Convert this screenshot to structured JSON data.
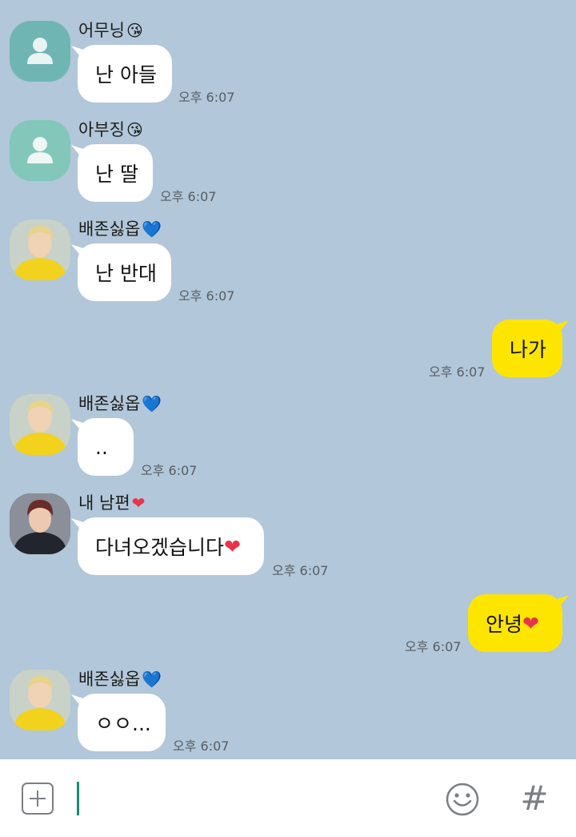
{
  "messages": [
    {
      "sender": "어무닝",
      "sender_emoji": "😘",
      "text": "난 아들",
      "time": "오후 6:07"
    },
    {
      "sender": "아부징",
      "sender_emoji": "😘",
      "text": "난 딸",
      "time": "오후 6:07"
    },
    {
      "sender": "배존싫옵",
      "sender_emoji": "💙",
      "text": "난 반대",
      "time": "오후 6:07"
    },
    {
      "text": "나가",
      "time": "오후 6:07"
    },
    {
      "sender": "배존싫옵",
      "sender_emoji": "💙",
      "text": "..",
      "time": "오후 6:07"
    },
    {
      "sender": "내 남편",
      "sender_emoji": "❤",
      "text": "다녀오겠습니다",
      "text_emoji": "❤",
      "time": "오후 6:07"
    },
    {
      "text": "안녕",
      "text_emoji": "❤",
      "time": "오후 6:07"
    },
    {
      "sender": "배존싫옵",
      "sender_emoji": "💙",
      "text": "ㅇㅇ...",
      "time": "오후 6:07"
    }
  ],
  "input": {
    "value": "",
    "placeholder": ""
  },
  "icons": {
    "attach": "plus-square-icon",
    "emoji": "smiley-icon",
    "hashtag": "hash-icon"
  },
  "colors": {
    "chat_background": "#b2c7d9",
    "incoming_bubble": "#ffffff",
    "outgoing_bubble": "#fee500",
    "cursor": "#1c8a75"
  }
}
